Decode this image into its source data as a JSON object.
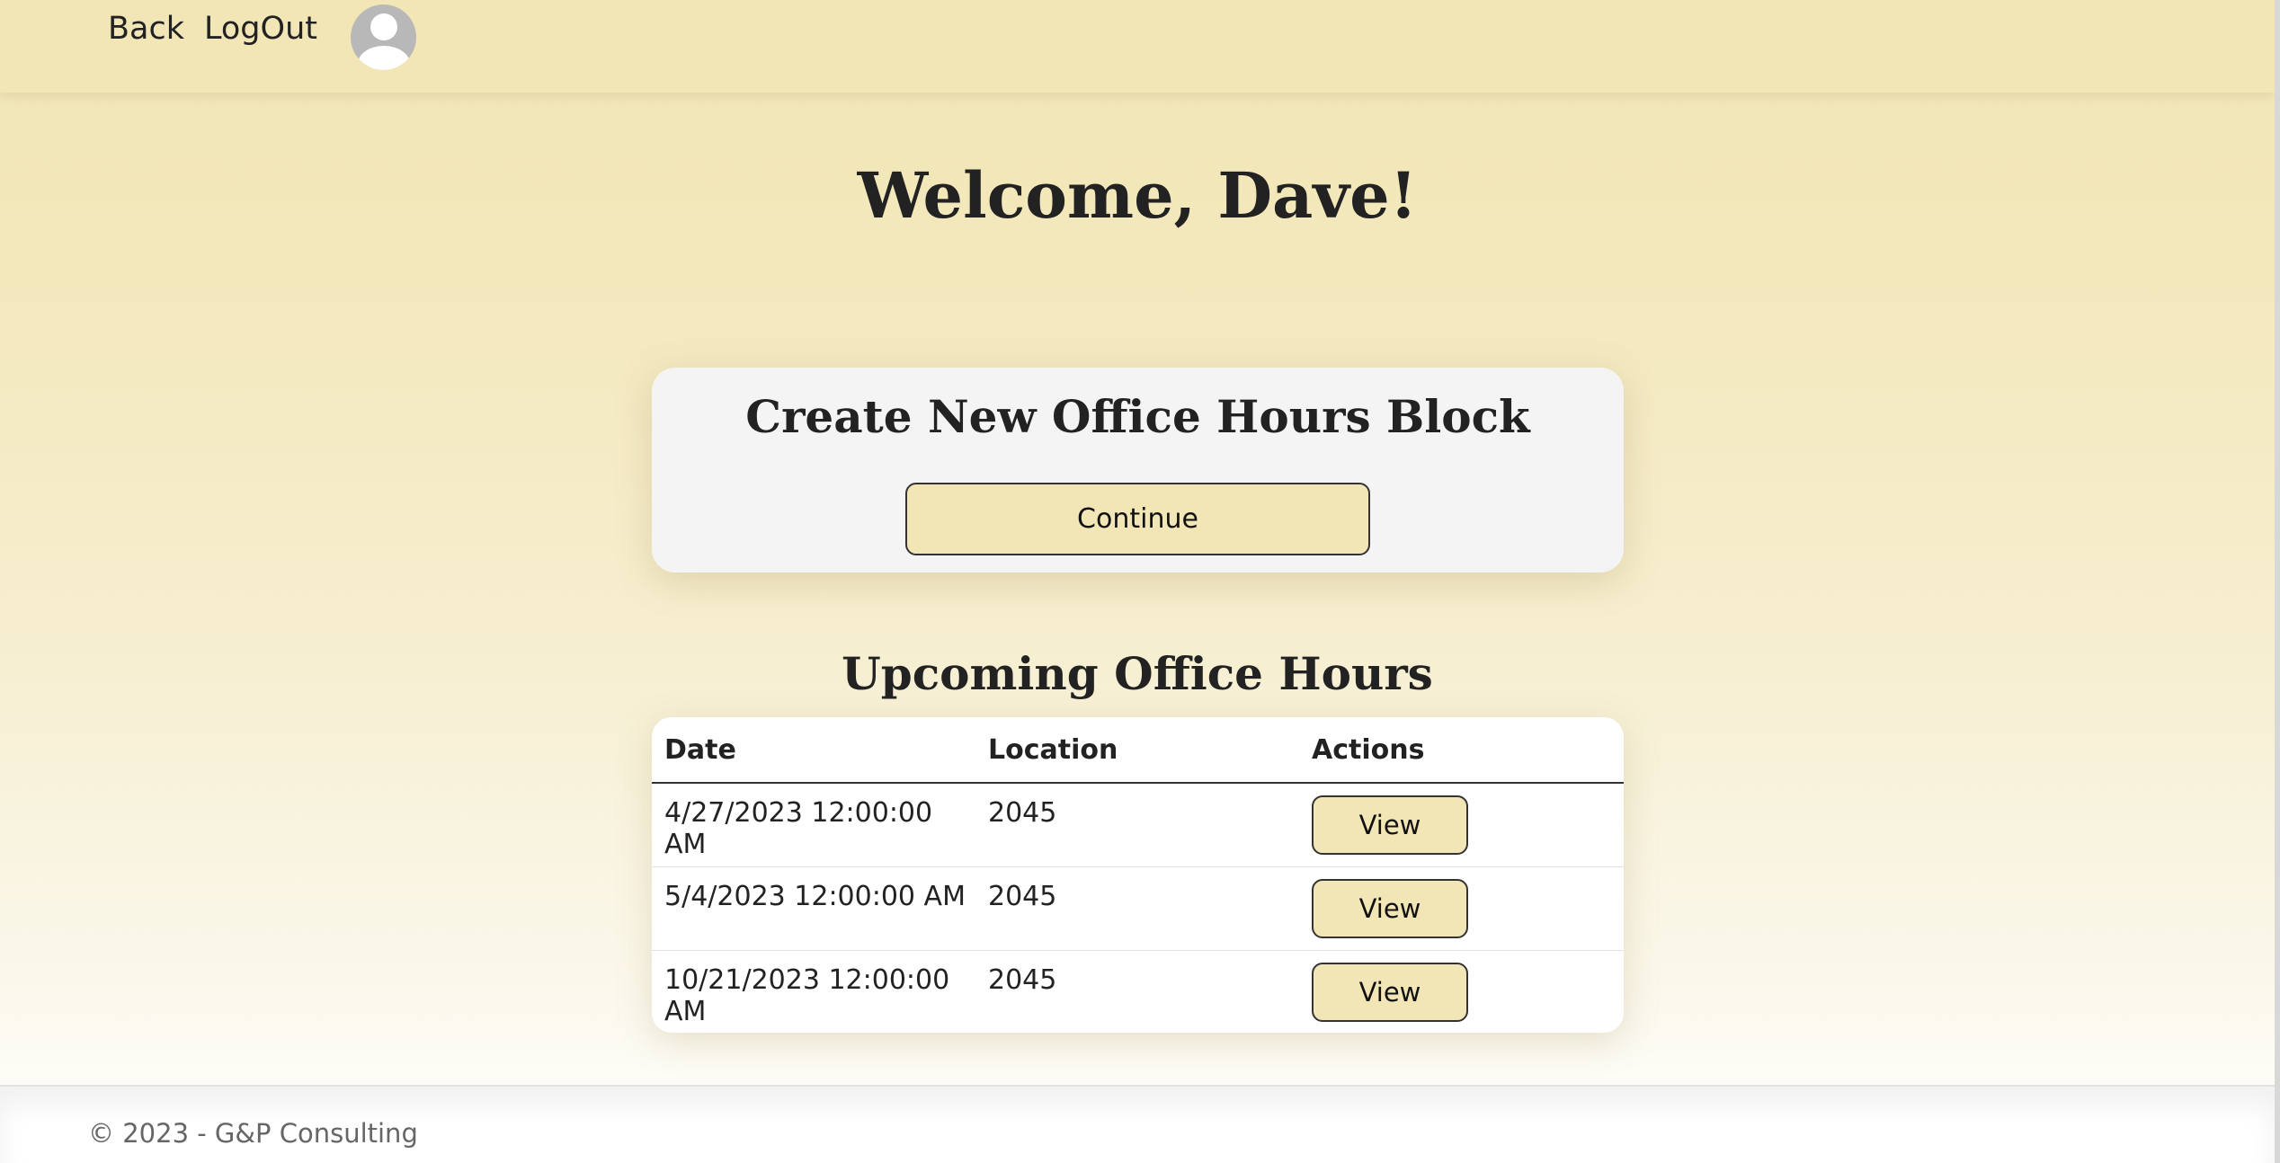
{
  "nav": {
    "back_label": "Back",
    "logout_label": "LogOut",
    "avatar_icon": "user-avatar-icon"
  },
  "welcome": {
    "heading": "Welcome, Dave!"
  },
  "create_card": {
    "title": "Create New Office Hours Block",
    "continue_label": "Continue"
  },
  "upcoming": {
    "title": "Upcoming Office Hours",
    "columns": [
      "Date",
      "Location",
      "Actions"
    ],
    "rows": [
      {
        "date": "4/27/2023 12:00:00 AM",
        "location": "2045",
        "action_label": "View"
      },
      {
        "date": "5/4/2023 12:00:00 AM",
        "location": "2045",
        "action_label": "View"
      },
      {
        "date": "10/21/2023 12:00:00 AM",
        "location": "2045",
        "action_label": "View"
      }
    ]
  },
  "footer": {
    "text": "© 2023 - G&P Consulting"
  },
  "colors": {
    "accent": "#f2e6b6",
    "card_bg": "#f4f4f4",
    "text": "#222222"
  }
}
